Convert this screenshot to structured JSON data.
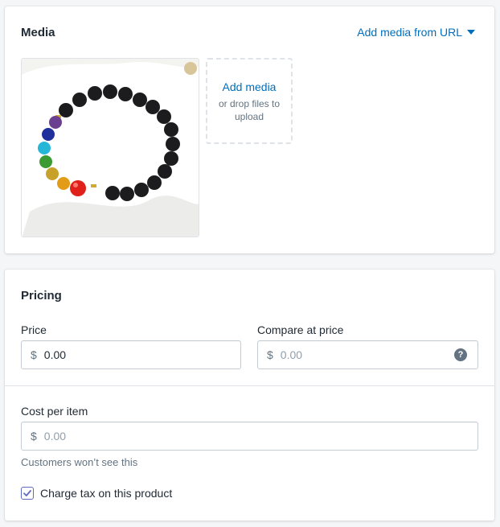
{
  "media": {
    "title": "Media",
    "add_from_url": "Add media from URL",
    "dropzone_title": "Add media",
    "dropzone_sub": "or drop files to upload",
    "image_alt": "Black bead bracelet with colorful chakra stones"
  },
  "pricing": {
    "title": "Pricing",
    "price_label": "Price",
    "price_prefix": "$",
    "price_value": "0.00",
    "compare_label": "Compare at price",
    "compare_prefix": "$",
    "compare_placeholder": "0.00",
    "help_glyph": "?",
    "cost_label": "Cost per item",
    "cost_prefix": "$",
    "cost_placeholder": "0.00",
    "cost_help": "Customers won’t see this",
    "charge_tax_label": "Charge tax on this product",
    "charge_tax_checked": true
  },
  "colors": {
    "link": "#006fbb",
    "accent": "#5c6ac4"
  }
}
